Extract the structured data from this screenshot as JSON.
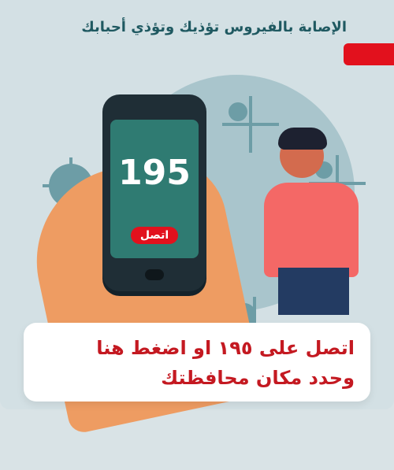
{
  "header": {
    "headline": "الإصابة بالفيروس تؤذيك وتؤذي أحبابك"
  },
  "phone": {
    "number": "195",
    "call_button_label": "اتصل"
  },
  "banner": {
    "line1": "اتصل على ١٩٥ او اضغط هنا",
    "line2": "وحدد مكان محافظتك"
  },
  "colors": {
    "accent_red": "#e2111d",
    "text_red": "#c41921",
    "bg_blue": "#d3e0e4",
    "screen_green": "#2f7b72",
    "shirt_pink": "#f46866"
  }
}
